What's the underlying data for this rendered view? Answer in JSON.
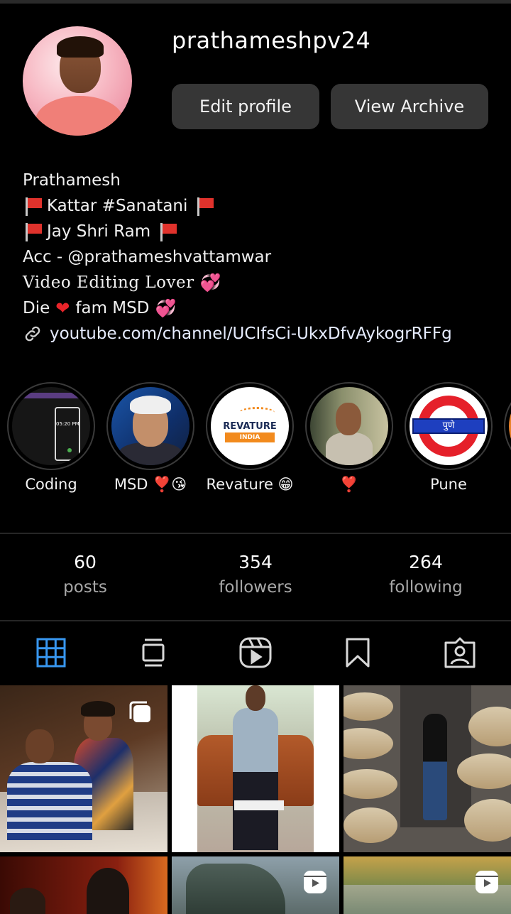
{
  "profile": {
    "username": "prathameshpv24",
    "edit_label": "Edit profile",
    "archive_label": "View Archive"
  },
  "bio": {
    "name": "Prathamesh",
    "line1": "Kattar #Sanatani",
    "line2": "Jay Shri Ram",
    "line3": "Acc - @prathameshvattamwar",
    "line4": "Video Editing Lover",
    "line5_a": "Die",
    "line5_b": "fam MSD",
    "link": "youtube.com/channel/UCIfsCi-UkxDfvAykogrRFFg"
  },
  "highlights": [
    {
      "label": "Coding"
    },
    {
      "label": "MSD ❣️😘"
    },
    {
      "label": "Revature 😁"
    },
    {
      "label": "❣️"
    },
    {
      "label": "Pune"
    }
  ],
  "highlight_art": {
    "coding_time": "05:20 PM",
    "revature_brand": "REVATURE",
    "revature_sub": "INDIA",
    "pune_sign": "पुणे"
  },
  "stats": {
    "posts_count": "60",
    "posts_label": "posts",
    "followers_count": "354",
    "followers_label": "followers",
    "following_count": "264",
    "following_label": "following"
  },
  "tabs": [
    {
      "icon": "grid-icon",
      "active": true
    },
    {
      "icon": "feed-icon",
      "active": false
    },
    {
      "icon": "reels-icon",
      "active": false
    },
    {
      "icon": "saved-icon",
      "active": false
    },
    {
      "icon": "tagged-icon",
      "active": false
    }
  ],
  "colors": {
    "background": "#000000",
    "button": "#363636",
    "active_tab": "#3897f0",
    "muted_text": "#a8a8a8"
  }
}
